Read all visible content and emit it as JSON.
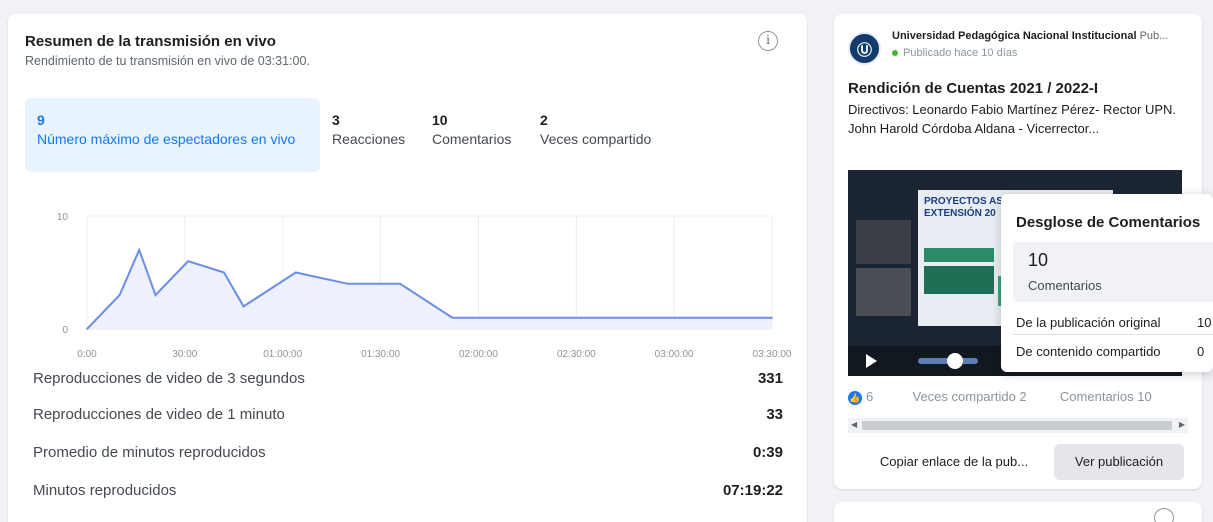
{
  "summary": {
    "title": "Resumen de la transmisión en vivo",
    "subtitle": "Rendimiento de tu transmisión en vivo de 03:31:00.",
    "info_glyph": "i",
    "metrics": [
      {
        "value": "9",
        "label": "Número máximo de espectadores en vivo",
        "active": true
      },
      {
        "value": "3",
        "label": "Reacciones",
        "active": false
      },
      {
        "value": "10",
        "label": "Comentarios",
        "active": false
      },
      {
        "value": "2",
        "label": "Veces compartido",
        "active": false
      }
    ],
    "stats": [
      {
        "label": "Reproducciones de video de 3 segundos",
        "value": "331"
      },
      {
        "label": "Reproducciones de video de 1 minuto",
        "value": "33"
      },
      {
        "label": "Promedio de minutos reproducidos",
        "value": "0:39"
      },
      {
        "label": "Minutos reproducidos",
        "value": "07:19:22"
      }
    ]
  },
  "chart_data": {
    "type": "area",
    "title": "",
    "xlabel": "",
    "ylabel": "",
    "x_tick_labels": [
      "0:00",
      "30:00",
      "01:00:00",
      "01:30:00",
      "02:00:00",
      "02:30:00",
      "03:00:00",
      "03:30:00"
    ],
    "y_tick_labels": [
      "10",
      "0"
    ],
    "ylim": [
      0,
      10
    ],
    "xlim_minutes": [
      0,
      210
    ],
    "grid": true,
    "series": [
      {
        "x_minutes": [
          0,
          10,
          16,
          21,
          31,
          42,
          48,
          64,
          80,
          96,
          112,
          210
        ],
        "values": [
          0,
          3,
          7,
          3,
          6,
          5,
          2,
          5,
          4,
          4,
          1,
          1
        ]
      }
    ],
    "color": "#6b8fe3",
    "fill": "#eef1fb"
  },
  "post": {
    "page_name": "Universidad Pedagógica Nacional Institucional",
    "page_suffix": "Pub...",
    "logo_text": "Ⓤ",
    "meta": "Publicado hace 10 días",
    "title": "Rendición de Cuentas 2021 / 2022-I",
    "description": "Directivos: Leonardo Fabio Martínez Pérez- Rector UPN. John Harold Córdoba Aldana - Vicerrector...",
    "slide_title": "PROYECTOS AS EXTENSIÓN 20",
    "likes": "6",
    "shares": "Veces compartido 2",
    "comments": "Comentarios 10",
    "copy_button": "Copiar enlace de la pub...",
    "view_button": "Ver publicación"
  },
  "popover": {
    "title": "Desglose de Comentarios",
    "total": "10",
    "total_label": "Comentarios",
    "rows": [
      {
        "label": "De la publicación original",
        "value": "10"
      },
      {
        "label": "De contenido compartido",
        "value": "0"
      }
    ]
  }
}
